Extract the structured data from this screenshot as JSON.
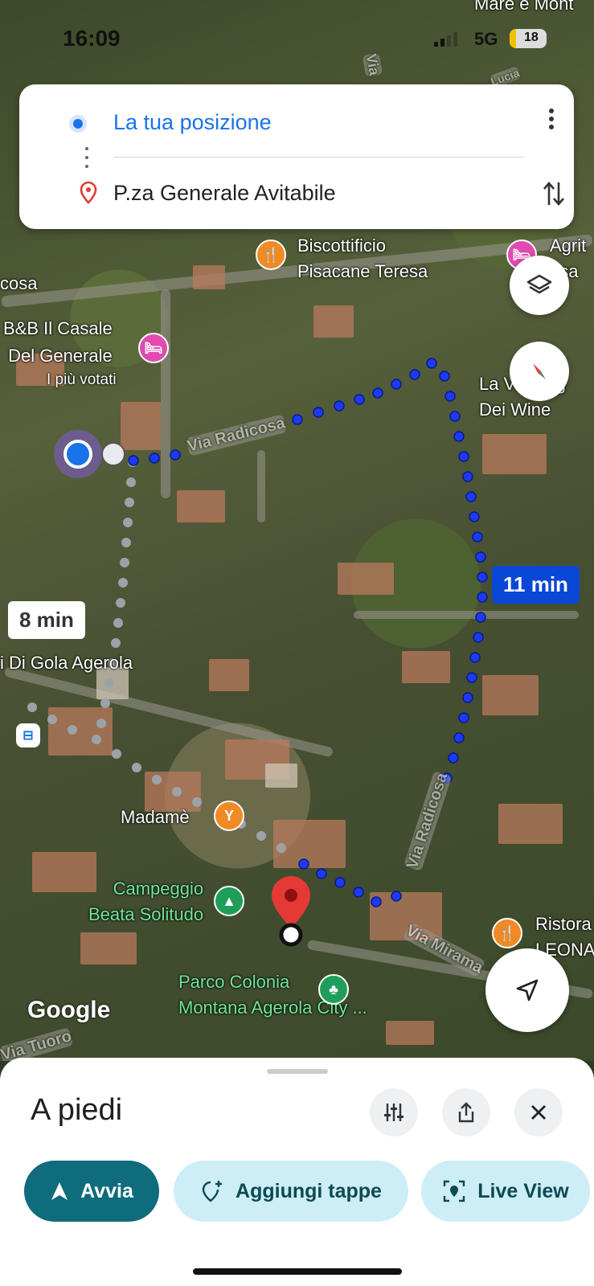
{
  "status": {
    "time": "16:09",
    "network": "5G",
    "battery": "18"
  },
  "directions": {
    "origin": "La tua posizione",
    "destination": "P.za Generale Avitabile"
  },
  "map": {
    "labels": {
      "biscottificio": "Biscottificio\nPisacane Teresa",
      "bnb": "B&B Il Casale\nDel Generale",
      "bnb_badge": "I più votati",
      "agri": "Agrit\nasa",
      "cosa": "cosa",
      "wine": "La V... Deg\nDei Wine",
      "via_radicosa_1": "Via Radicosa",
      "via_radicosa_2": "Via Radicosa",
      "via_mirama": "Via Mirama",
      "gola": "i Di Gola Agerola",
      "madame": "Madamè",
      "campeggio": "Campeggio\nBeata Solitudo",
      "parco": "Parco Colonia\nMontana Agerola City ...",
      "ristoro": "Ristora\nLEONA",
      "via_tuoro": "Via Tuoro",
      "mare": "Mare e Mont",
      "lucia": "Lucia",
      "via_top": "Via"
    },
    "time_alt": "8 min",
    "time_main": "11 min",
    "google": "Google"
  },
  "sheet": {
    "mode": "A piedi",
    "start": "Avvia",
    "add_stops": "Aggiungi tappe",
    "live_view": "Live View"
  }
}
